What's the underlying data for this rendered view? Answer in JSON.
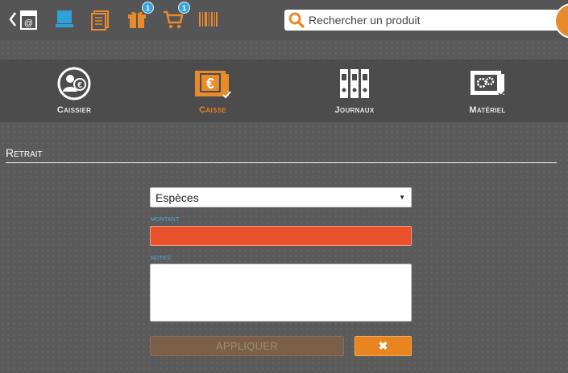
{
  "toolbar": {
    "back_icon": "back-chevron-icon",
    "items": [
      {
        "icon": "shop-icon"
      },
      {
        "icon": "laptop-icon",
        "color": "#2fa0d8"
      },
      {
        "icon": "document-icon",
        "color": "#e98a2c"
      },
      {
        "icon": "gift-icon",
        "color": "#e98a2c",
        "badge": "1"
      },
      {
        "icon": "cart-icon",
        "color": "#e98a2c",
        "badge": "1"
      },
      {
        "icon": "barcode-icon",
        "color": "#e98a2c"
      }
    ]
  },
  "search": {
    "placeholder": "Rechercher un produit",
    "icon": "search-icon",
    "accent": "#e98a2c"
  },
  "tabs": [
    {
      "label": "Caissier",
      "icon": "cashier-euro-icon",
      "active": false
    },
    {
      "label": "Caisse",
      "icon": "cash-register-euro-icon",
      "active": true
    },
    {
      "label": "Journaux",
      "icon": "binders-icon",
      "active": false
    },
    {
      "label": "Matériel",
      "icon": "hardware-gears-icon",
      "active": false
    }
  ],
  "section": {
    "title": "Retrait"
  },
  "form": {
    "payment_method": "Espèces",
    "amount_label": "MONTANT",
    "amount_value": "",
    "notes_label": "NOTES",
    "notes_value": "",
    "apply_label": "APPLIQUER",
    "cancel_symbol": "✖"
  },
  "colors": {
    "accent": "#e98a2c",
    "info": "#2fa0d8",
    "amount_bg": "#e8512a"
  }
}
